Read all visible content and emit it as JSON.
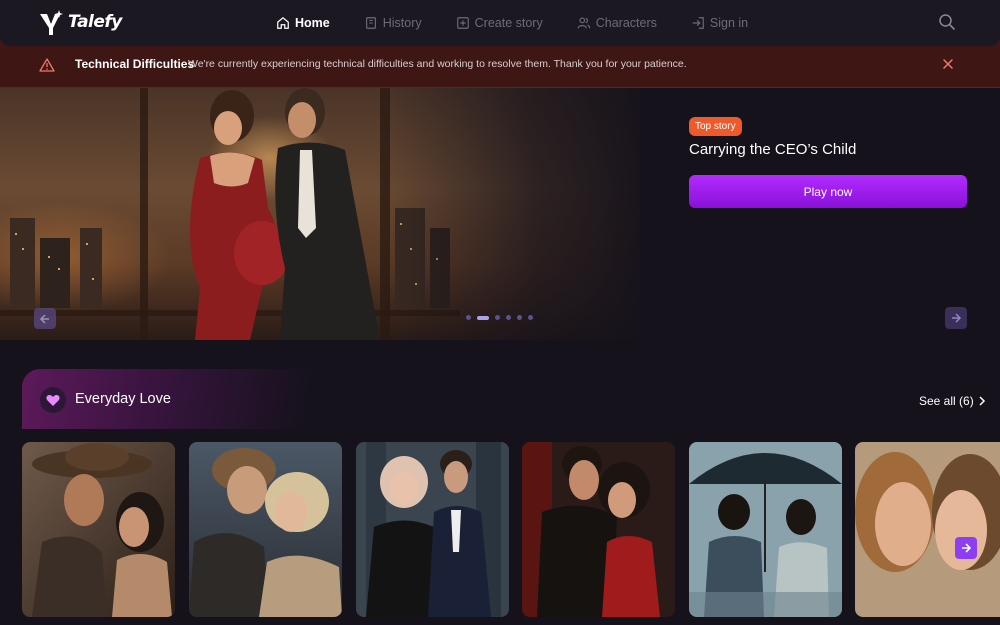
{
  "brand": {
    "name": "Talefy"
  },
  "nav": {
    "items": [
      {
        "label": "Home",
        "icon": "home-icon",
        "active": true
      },
      {
        "label": "History",
        "icon": "history-icon",
        "active": false
      },
      {
        "label": "Create story",
        "icon": "create-story-icon",
        "active": false
      },
      {
        "label": "Characters",
        "icon": "characters-icon",
        "active": false
      },
      {
        "label": "Sign in",
        "icon": "sign-in-icon",
        "active": false
      }
    ]
  },
  "alert": {
    "title": "Technical Difficulties",
    "message": "We're currently experiencing technical difficulties and working to resolve them. Thank you for your patience."
  },
  "hero": {
    "badge": "Top story",
    "title": "Carrying the CEO’s Child",
    "cta": "Play now",
    "slide_count": 6,
    "active_slide": 2
  },
  "section": {
    "title": "Everyday Love",
    "icon": "heart-icon",
    "see_all": "See all (6)",
    "cards": [
      {
        "name": "story-card-cowboy"
      },
      {
        "name": "story-card-embrace"
      },
      {
        "name": "story-card-couple-city"
      },
      {
        "name": "story-card-red-dress"
      },
      {
        "name": "story-card-umbrella"
      },
      {
        "name": "story-card-kiss"
      }
    ]
  },
  "colors": {
    "background": "#15121b",
    "nav": "#1c1822",
    "alert_bg": "#3e1715",
    "accent_purple": "#9b1fef",
    "badge_orange": "#ee5a2c"
  }
}
